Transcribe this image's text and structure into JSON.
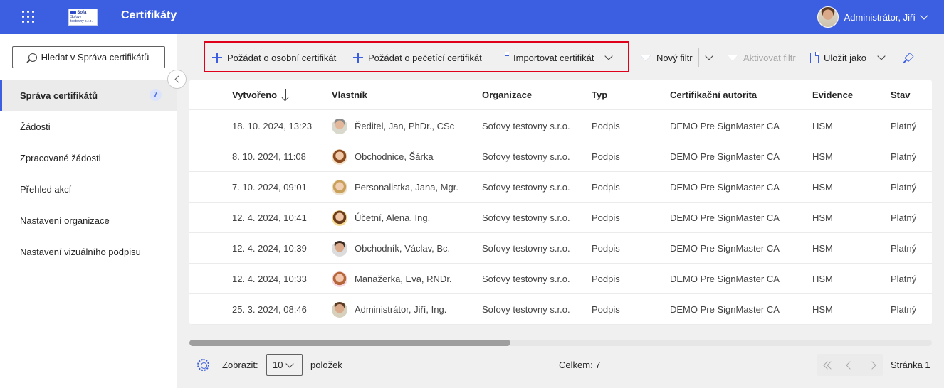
{
  "app": {
    "title": "Certifikáty",
    "logo_text": "Sofa",
    "logo_sub": "Sofovy testovny s.r.o.",
    "user_name": "Administrátor, Jiří"
  },
  "sidebar": {
    "search_placeholder": "Hledat v Správa certifikátů",
    "items": [
      {
        "label": "Správa certifikátů",
        "badge": "7",
        "active": true
      },
      {
        "label": "Žádosti"
      },
      {
        "label": "Zpracované žádosti"
      },
      {
        "label": "Přehled akcí"
      },
      {
        "label": "Nastavení organizace"
      },
      {
        "label": "Nastavení vizuálního podpisu"
      }
    ]
  },
  "toolbar": {
    "request_personal": "Požádat o osobní certifikát",
    "request_seal": "Požádat o pečetící certifikát",
    "import_cert": "Importovat certifikát",
    "new_filter": "Nový filtr",
    "activate_filter": "Aktivovat filtr",
    "save_as": "Uložit jako"
  },
  "table": {
    "columns": [
      "Vytvořeno",
      "Vlastník",
      "Organizace",
      "Typ",
      "Certifikační autorita",
      "Evidence",
      "Stav"
    ],
    "rows": [
      {
        "created": "18. 10. 2024, 13:23",
        "owner": "Ředitel, Jan, PhDr., CSc",
        "org": "Sofovy testovny s.r.o.",
        "type": "Podpis",
        "ca": "DEMO Pre SignMaster CA",
        "evidence": "HSM",
        "status": "Platný"
      },
      {
        "created": "8. 10. 2024, 11:08",
        "owner": "Obchodnice, Šárka",
        "org": "Sofovy testovny s.r.o.",
        "type": "Podpis",
        "ca": "DEMO Pre SignMaster CA",
        "evidence": "HSM",
        "status": "Platný"
      },
      {
        "created": "7. 10. 2024, 09:01",
        "owner": "Personalistka, Jana, Mgr.",
        "org": "Sofovy testovny s.r.o.",
        "type": "Podpis",
        "ca": "DEMO Pre SignMaster CA",
        "evidence": "HSM",
        "status": "Platný"
      },
      {
        "created": "12. 4. 2024, 10:41",
        "owner": "Účetní, Alena, Ing.",
        "org": "Sofovy testovny s.r.o.",
        "type": "Podpis",
        "ca": "DEMO Pre SignMaster CA",
        "evidence": "HSM",
        "status": "Platný"
      },
      {
        "created": "12. 4. 2024, 10:39",
        "owner": "Obchodník, Václav, Bc.",
        "org": "Sofovy testovny s.r.o.",
        "type": "Podpis",
        "ca": "DEMO Pre SignMaster CA",
        "evidence": "HSM",
        "status": "Platný"
      },
      {
        "created": "12. 4. 2024, 10:33",
        "owner": "Manažerka, Eva, RNDr.",
        "org": "Sofovy testovny s.r.o.",
        "type": "Podpis",
        "ca": "DEMO Pre SignMaster CA",
        "evidence": "HSM",
        "status": "Platný"
      },
      {
        "created": "25. 3. 2024, 08:46",
        "owner": "Administrátor, Jiří, Ing.",
        "org": "Sofovy testovny s.r.o.",
        "type": "Podpis",
        "ca": "DEMO Pre SignMaster CA",
        "evidence": "HSM",
        "status": "Platný"
      }
    ]
  },
  "footer": {
    "show_label": "Zobrazit:",
    "page_size": "10",
    "items_label": "položek",
    "total": "Celkem: 7",
    "page": "Stránka 1"
  },
  "colors": {
    "accent": "#3b5fe0",
    "highlight_border": "#e0001b"
  }
}
